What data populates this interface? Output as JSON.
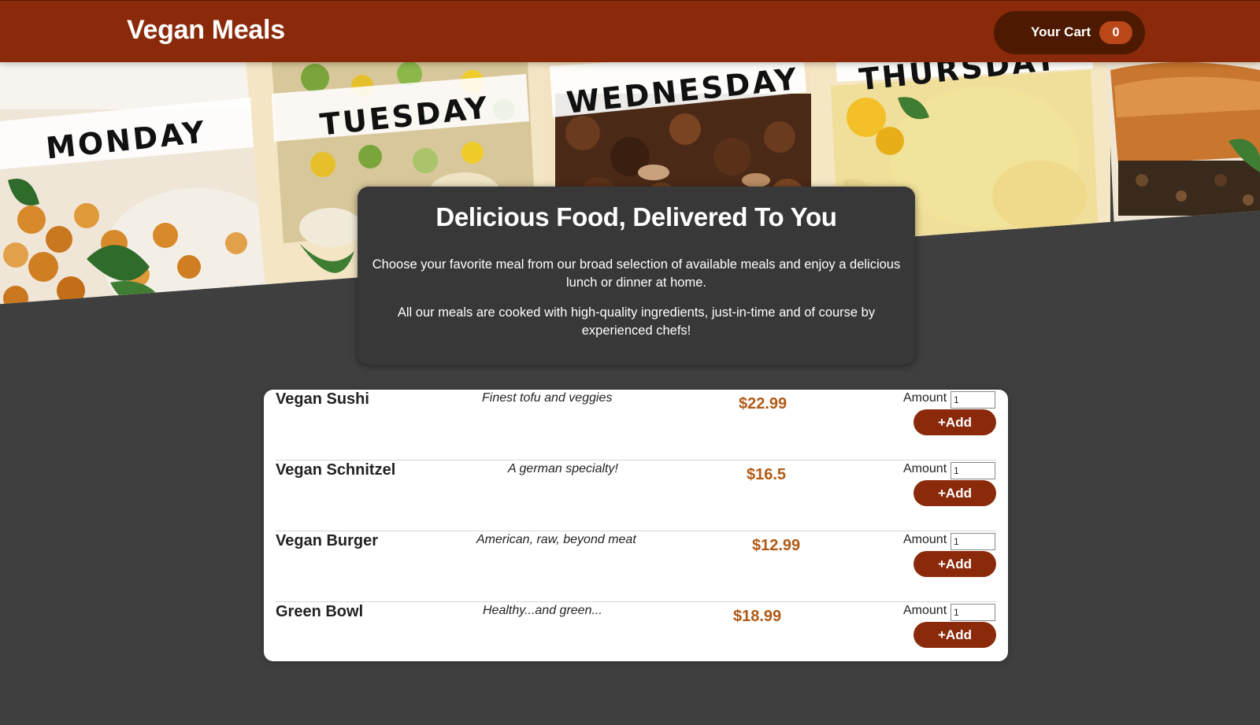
{
  "header": {
    "brand": "Vegan Meals",
    "cart_label": "Your Cart",
    "cart_count": "0"
  },
  "hero": {
    "days": [
      "MONDAY",
      "TUESDAY",
      "WEDNESDAY",
      "THURSDAY"
    ]
  },
  "summary": {
    "title": "Delicious Food, Delivered To You",
    "paragraph1": "Choose your favorite meal from our broad selection of available meals and enjoy a delicious lunch or dinner at home.",
    "paragraph2": "All our meals are cooked with high-quality ingredients, just-in-time and of course by experienced chefs!"
  },
  "meals": [
    {
      "name": "Vegan Sushi",
      "description": "Finest tofu and veggies",
      "price": "$22.99",
      "amount_label": "Amount",
      "amount": "1",
      "add_label": "+Add"
    },
    {
      "name": "Vegan Schnitzel",
      "description": "A german specialty!",
      "price": "$16.5",
      "amount_label": "Amount",
      "amount": "1",
      "add_label": "+Add"
    },
    {
      "name": "Vegan Burger",
      "description": "American, raw, beyond meat",
      "price": "$12.99",
      "amount_label": "Amount",
      "amount": "1",
      "add_label": "+Add"
    },
    {
      "name": "Green Bowl",
      "description": "Healthy...and green...",
      "price": "$18.99",
      "amount_label": "Amount",
      "amount": "1",
      "add_label": "+Add"
    }
  ],
  "colors": {
    "header": "#8a2a0b",
    "cart_button": "#4d1900",
    "badge": "#b94718",
    "background": "#3f3f3f",
    "summary_card": "#383838",
    "price": "#b05a16"
  }
}
